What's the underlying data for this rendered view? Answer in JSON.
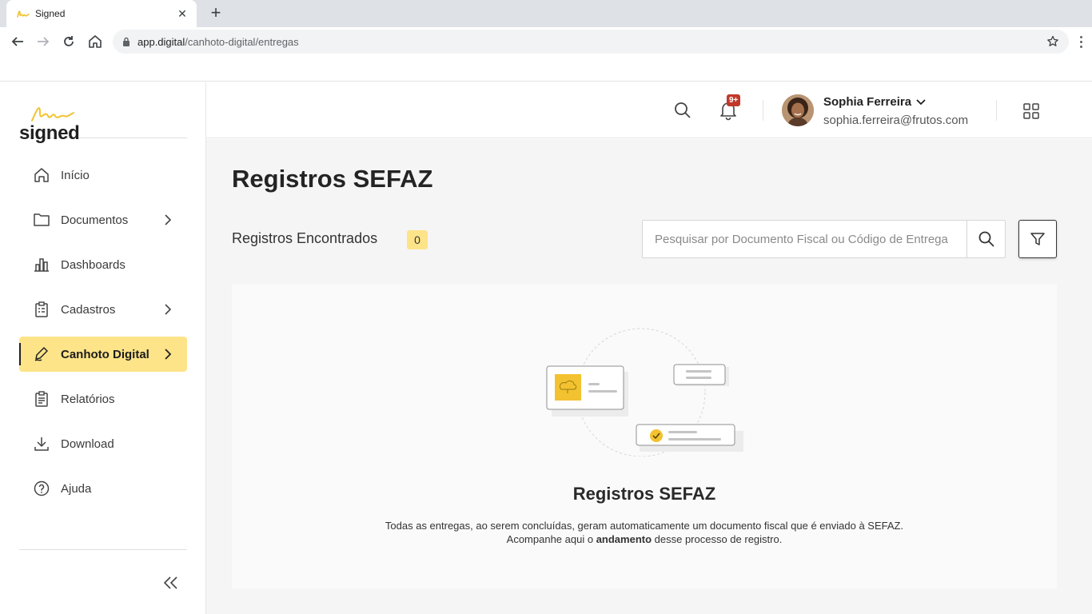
{
  "browser": {
    "tab_title": "Signed",
    "url_host": "app.digital",
    "url_path": "/canhoto-digital/entregas"
  },
  "brand": {
    "logo_text": "signed",
    "accent": "#f2c230",
    "active_bg": "#fde489"
  },
  "sidebar": {
    "items": [
      {
        "label": "Início",
        "icon": "home-icon"
      },
      {
        "label": "Documentos",
        "icon": "folder-icon"
      },
      {
        "label": "Dashboards",
        "icon": "bar-chart-icon"
      },
      {
        "label": "Cadastros",
        "icon": "clipboard-icon"
      },
      {
        "label": "Canhoto Digital",
        "icon": "signature-pen-icon"
      },
      {
        "label": "Relatórios",
        "icon": "report-icon"
      },
      {
        "label": "Download",
        "icon": "download-icon"
      },
      {
        "label": "Ajuda",
        "icon": "help-icon"
      }
    ]
  },
  "header": {
    "notifications_badge": "9+",
    "user_name": "Sophia Ferreira",
    "user_email": "sophia.ferreira@frutos.com"
  },
  "main": {
    "page_title": "Registros SEFAZ",
    "count_label": "Registros Encontrados",
    "count_value": "0",
    "search_placeholder": "Pesquisar por Documento Fiscal ou Código de Entrega",
    "empty_title": "Registros SEFAZ",
    "empty_desc_line1": "Todas as entregas, ao serem concluídas, geram automaticamente um documento fiscal que é enviado à SEFAZ.",
    "empty_desc_line2_pre": "Acompanhe aqui o ",
    "empty_desc_line2_bold": "andamento",
    "empty_desc_line2_post": " desse processo de registro."
  }
}
